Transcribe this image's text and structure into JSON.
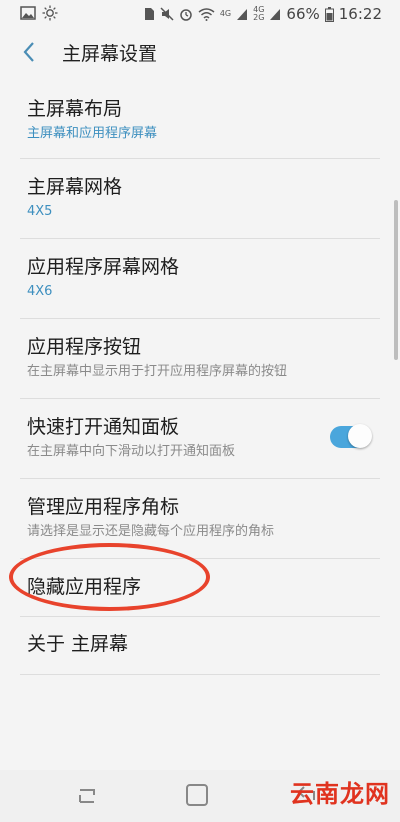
{
  "status_bar": {
    "left_icons": [
      "image-icon",
      "brightness-icon"
    ],
    "right_icons": [
      "sim-icon",
      "mute-icon",
      "alarm-icon",
      "wifi-icon"
    ],
    "network_1": "4G",
    "network_2a": "4G",
    "network_2b": "2G",
    "battery": "66%",
    "time": "16:22"
  },
  "header": {
    "title": "主屏幕设置"
  },
  "settings": [
    {
      "title": "主屏幕布局",
      "subtitle": "主屏幕和应用程序屏幕"
    },
    {
      "title": "主屏幕网格",
      "subtitle": "4X5"
    },
    {
      "title": "应用程序屏幕网格",
      "subtitle": "4X6"
    },
    {
      "title": "应用程序按钮",
      "subtitle": "在主屏幕中显示用于打开应用程序屏幕的按钮"
    },
    {
      "title": "快速打开通知面板",
      "subtitle": "在主屏幕中向下滑动以打开通知面板",
      "toggle_on": true
    },
    {
      "title": "管理应用程序角标",
      "subtitle": "请选择是显示还是隐藏每个应用程序的角标"
    },
    {
      "title": "隐藏应用程序"
    },
    {
      "title": "关于 主屏幕"
    }
  ],
  "watermark": "云南龙网",
  "colors": {
    "accent": "#3d8fbf",
    "toggle": "#4aa6dc",
    "highlight": "#e8432c"
  }
}
